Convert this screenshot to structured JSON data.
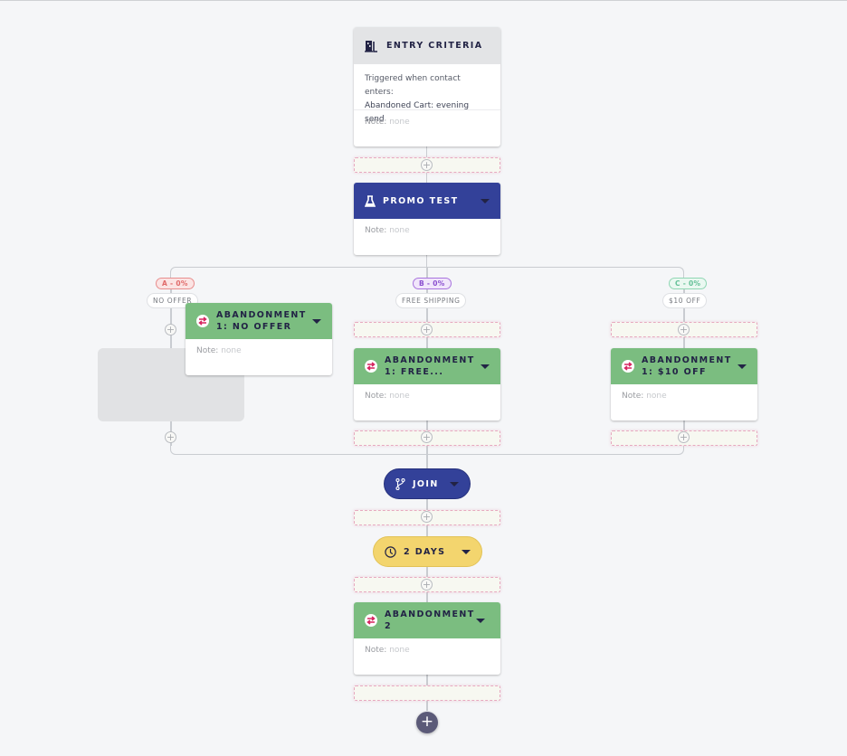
{
  "entry": {
    "title": "ENTRY CRITERIA",
    "icon": "building-door-icon",
    "line1": "Triggered when contact enters:",
    "line2": "Abandoned Cart: evening send",
    "note_label": "Note:",
    "note_value": "none"
  },
  "promo": {
    "title": "PROMO TEST",
    "icon": "flask-icon",
    "note_label": "Note:",
    "note_value": "none"
  },
  "branches": [
    {
      "pct": "A - 0%",
      "label": "NO OFFER",
      "card_title": "ABANDONMENT 1: NO OFFER",
      "note_label": "Note:",
      "note_value": "none"
    },
    {
      "pct": "B - 0%",
      "label": "FREE SHIPPING",
      "card_title": "ABANDONMENT 1: FREE...",
      "note_label": "Note:",
      "note_value": "none"
    },
    {
      "pct": "C - 0%",
      "label": "$10 OFF",
      "card_title": "ABANDONMENT 1: $10 OFF",
      "note_label": "Note:",
      "note_value": "none"
    }
  ],
  "join": {
    "title": "JOIN",
    "icon": "branch-merge-icon"
  },
  "wait": {
    "title": "2 DAYS",
    "icon": "clock-icon"
  },
  "final": {
    "title": "ABANDONMENT 2",
    "note_label": "Note:",
    "note_value": "none"
  },
  "add_button": {
    "label": "+"
  },
  "plus_glyph": "+",
  "colors": {
    "entry_header": "#e3e4e6",
    "promo_header": "#334199",
    "email_header": "#7bbd80",
    "join": "#334199",
    "wait": "#f3d56e",
    "branch_a": "#e06a6a",
    "branch_b": "#8a4fcf",
    "branch_c": "#63c097"
  }
}
